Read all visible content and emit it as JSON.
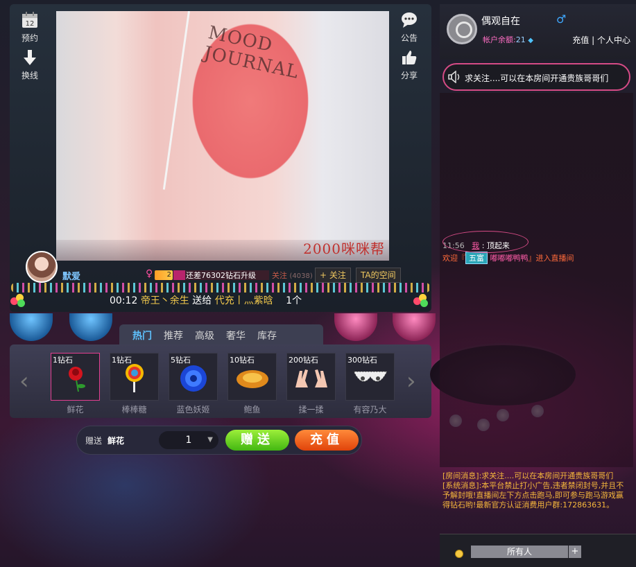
{
  "left_toolbar": {
    "reserve_label": "预约",
    "reserve_date": "12",
    "switch_label": "换线"
  },
  "right_toolbar": {
    "notice_label": "公告",
    "share_label": "分享"
  },
  "video": {
    "watermark": "2000咪咪帮"
  },
  "host": {
    "name": "默爱",
    "level": "2",
    "level_progress": 0.12,
    "upgrade_text": "还差76302钻石升级",
    "follow_text": "关注",
    "follow_count": "(4038)",
    "follow_button": "+ 关注",
    "space_button": "TA的空间"
  },
  "ticker": {
    "time": "00:12",
    "sender": "帝王丶余生",
    "verb": "送给",
    "receiver": "代充丨灬紫晗",
    "amount": "1个"
  },
  "gift_tabs": [
    "热门",
    "推荐",
    "高级",
    "奢华",
    "库存"
  ],
  "gifts": [
    {
      "price": "1钻石",
      "name": "鲜花"
    },
    {
      "price": "1钻石",
      "name": "棒棒糖"
    },
    {
      "price": "5钻石",
      "name": "蓝色妖姬"
    },
    {
      "price": "10钻石",
      "name": "鲍鱼"
    },
    {
      "price": "200钻石",
      "name": "揉一揉"
    },
    {
      "price": "300钻石",
      "name": "有容乃大"
    }
  ],
  "send": {
    "label": "赠送",
    "gift": "鲜花",
    "quantity": "1",
    "send_button": "赠送",
    "recharge_button": "充值"
  },
  "user": {
    "name": "偶观自在",
    "balance_label": "帐户余额:",
    "balance_value": "21",
    "recharge_link": "充值",
    "separator": "|",
    "center_link": "个人中心"
  },
  "notice": "求关注....可以在本房间开通贵族哥哥们",
  "chat": {
    "time": "11:56",
    "me": "我",
    "colon": ":",
    "message": "顶起来",
    "welcome_prefix": "欢迎『",
    "welcome_badge": "五富",
    "welcome_user": "嘟嘟嘟鸭鸭",
    "welcome_suffix": "』进入直播间"
  },
  "system_messages": {
    "room": "[房间消息]:求关注....可以在本房间开通贵族哥哥们",
    "system": "[系统消息]:本平台禁止打小广告,违者禁闭封号,并且不予解封哦!直播间左下方点击跑马,即可参与跑马游戏赢得钻石哟!最新官方认证消费用户群:172863631。"
  },
  "chat_input": {
    "target": "所有人",
    "plus": "+"
  }
}
